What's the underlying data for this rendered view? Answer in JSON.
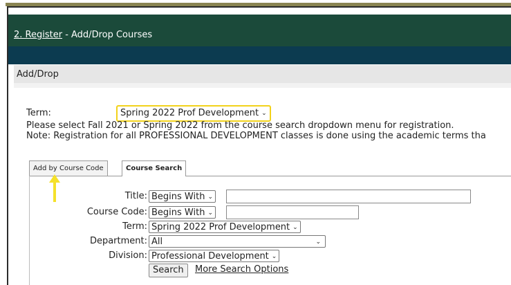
{
  "header": {
    "breadcrumb_link": "2. Register",
    "breadcrumb_rest": " - Add/Drop Courses"
  },
  "section": {
    "title": "Add/Drop"
  },
  "term": {
    "label": "Term:",
    "selected": "Spring 2022 Prof Development",
    "info_line1": "Please select Fall 2021 or Spring 2022 from the course search dropdown menu for registration.",
    "info_line2": "Note: Registration for all PROFESSIONAL DEVELOPMENT classes is done using the academic terms tha"
  },
  "tabs": [
    {
      "label": "Add by Course Code",
      "active": false
    },
    {
      "label": "Course Search",
      "active": true
    }
  ],
  "search_form": {
    "title_label": "Title:",
    "title_match": "Begins With",
    "title_value": "",
    "code_label": "Course Code:",
    "code_match": "Begins With",
    "code_value": "",
    "term_label": "Term:",
    "term_value": "Spring 2022 Prof Development",
    "department_label": "Department:",
    "department_value": "All",
    "division_label": "Division:",
    "division_value": "Professional Development",
    "search_button": "Search",
    "more_options_link": "More Search Options"
  },
  "colors": {
    "header_bg": "#1b4a3a",
    "subheader_bg": "#0c3b50",
    "highlight": "#f2d21a",
    "arrow": "#f5e12a"
  },
  "icons": {
    "select_chevron": "chevron-down-icon",
    "annotation_arrow": "arrow-up-icon"
  }
}
